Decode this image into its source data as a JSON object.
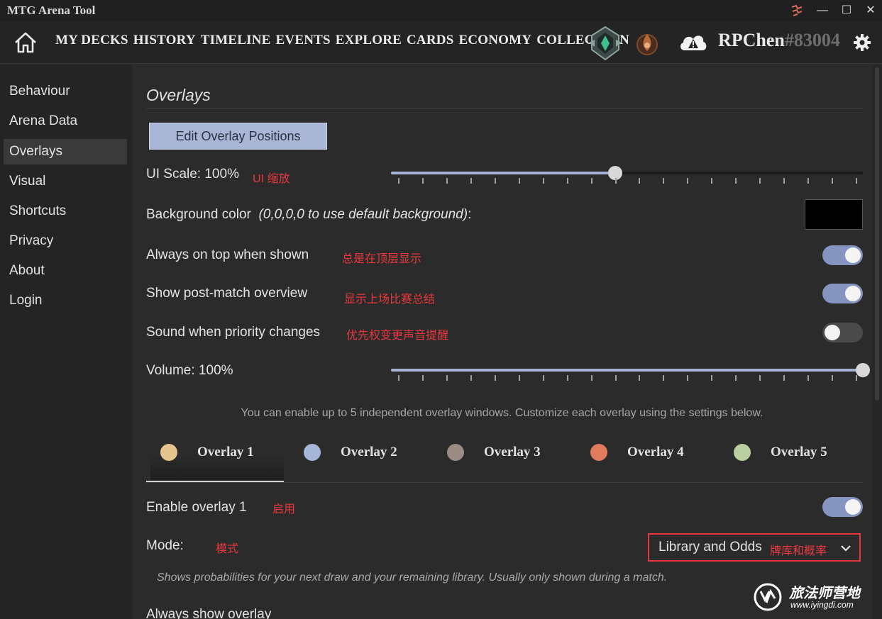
{
  "window": {
    "title": "MTG Arena Tool",
    "controls": {
      "minimize": "—",
      "maximize": "☐",
      "close": "✕"
    }
  },
  "nav": {
    "items": [
      "MY DECKS",
      "HISTORY",
      "TIMELINE",
      "EVENTS",
      "EXPLORE",
      "CARDS",
      "ECONOMY",
      "COLLECTION"
    ],
    "username": "RPChen",
    "user_tag": "#83004"
  },
  "sidebar": {
    "items": [
      "Behaviour",
      "Arena Data",
      "Overlays",
      "Visual",
      "Shortcuts",
      "Privacy",
      "About",
      "Login"
    ],
    "active_index": 2
  },
  "overlays": {
    "title": "Overlays",
    "edit_button": "Edit Overlay Positions",
    "ui_scale": {
      "label": "UI Scale: 100%",
      "cn": "UI 缩放",
      "fraction": 0.475
    },
    "background": {
      "label": "Background color",
      "hint": "(0,0,0,0 to use default background)",
      "suffix": ":",
      "value": "#000000"
    },
    "always_on_top": {
      "label": "Always on top when shown",
      "cn": "总是在顶层显示",
      "on": true
    },
    "post_match": {
      "label": "Show post-match overview",
      "cn": "显示上场比赛总结",
      "on": true
    },
    "sound_priority": {
      "label": "Sound when priority changes",
      "cn": "优先权变更声音提醒",
      "on": false
    },
    "volume": {
      "label": "Volume: 100%",
      "fraction": 1.0
    },
    "info": "You can enable up to 5 independent overlay windows. Customize each overlay using the settings below.",
    "tabs": [
      {
        "label": "Overlay 1",
        "color": "#e5c48e"
      },
      {
        "label": "Overlay 2",
        "color": "#a6b6d8"
      },
      {
        "label": "Overlay 3",
        "color": "#9a8b84"
      },
      {
        "label": "Overlay 4",
        "color": "#e07b5e"
      },
      {
        "label": "Overlay 5",
        "color": "#b9cf9f"
      }
    ],
    "active_tab": 0,
    "enable": {
      "label": "Enable overlay 1",
      "cn": "启用",
      "on": true
    },
    "mode": {
      "label": "Mode:",
      "cn": "模式",
      "value": "Library and Odds",
      "value_cn": "牌库和概率"
    },
    "mode_desc": "Shows probabilities for your next draw and your remaining library. Usually only shown during a match.",
    "always_show": "Always show overlay"
  },
  "watermark": {
    "cn": "旅法师营地",
    "url": "www.iyingdi.com"
  }
}
